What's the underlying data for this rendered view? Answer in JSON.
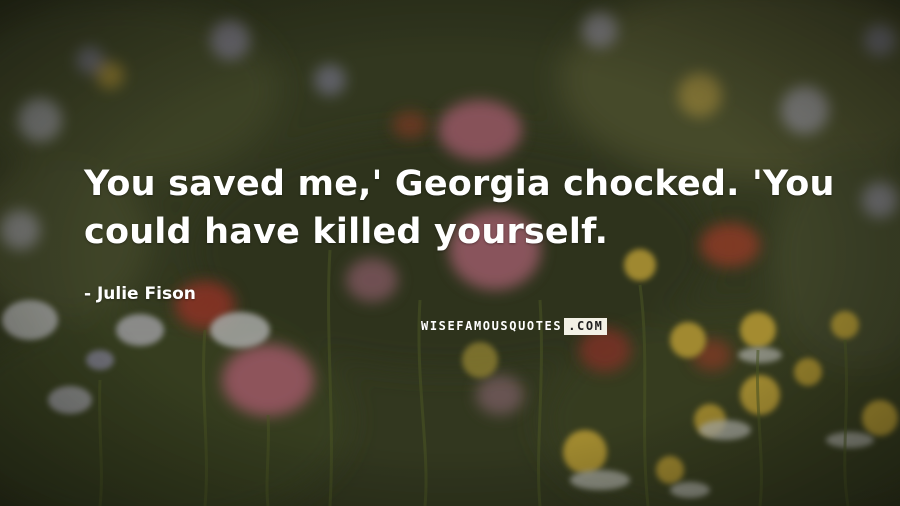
{
  "quote": {
    "text": "You saved me,' Georgia chocked. 'You could have killed yourself."
  },
  "author": {
    "text": "- Julie Fison"
  },
  "watermark": {
    "left": "WISEFAMOUSQUOTES",
    "right": ".COM"
  },
  "colors": {
    "text": "#ffffff",
    "watermark_box": "#f3f1e6",
    "background": "#3a3f26"
  }
}
